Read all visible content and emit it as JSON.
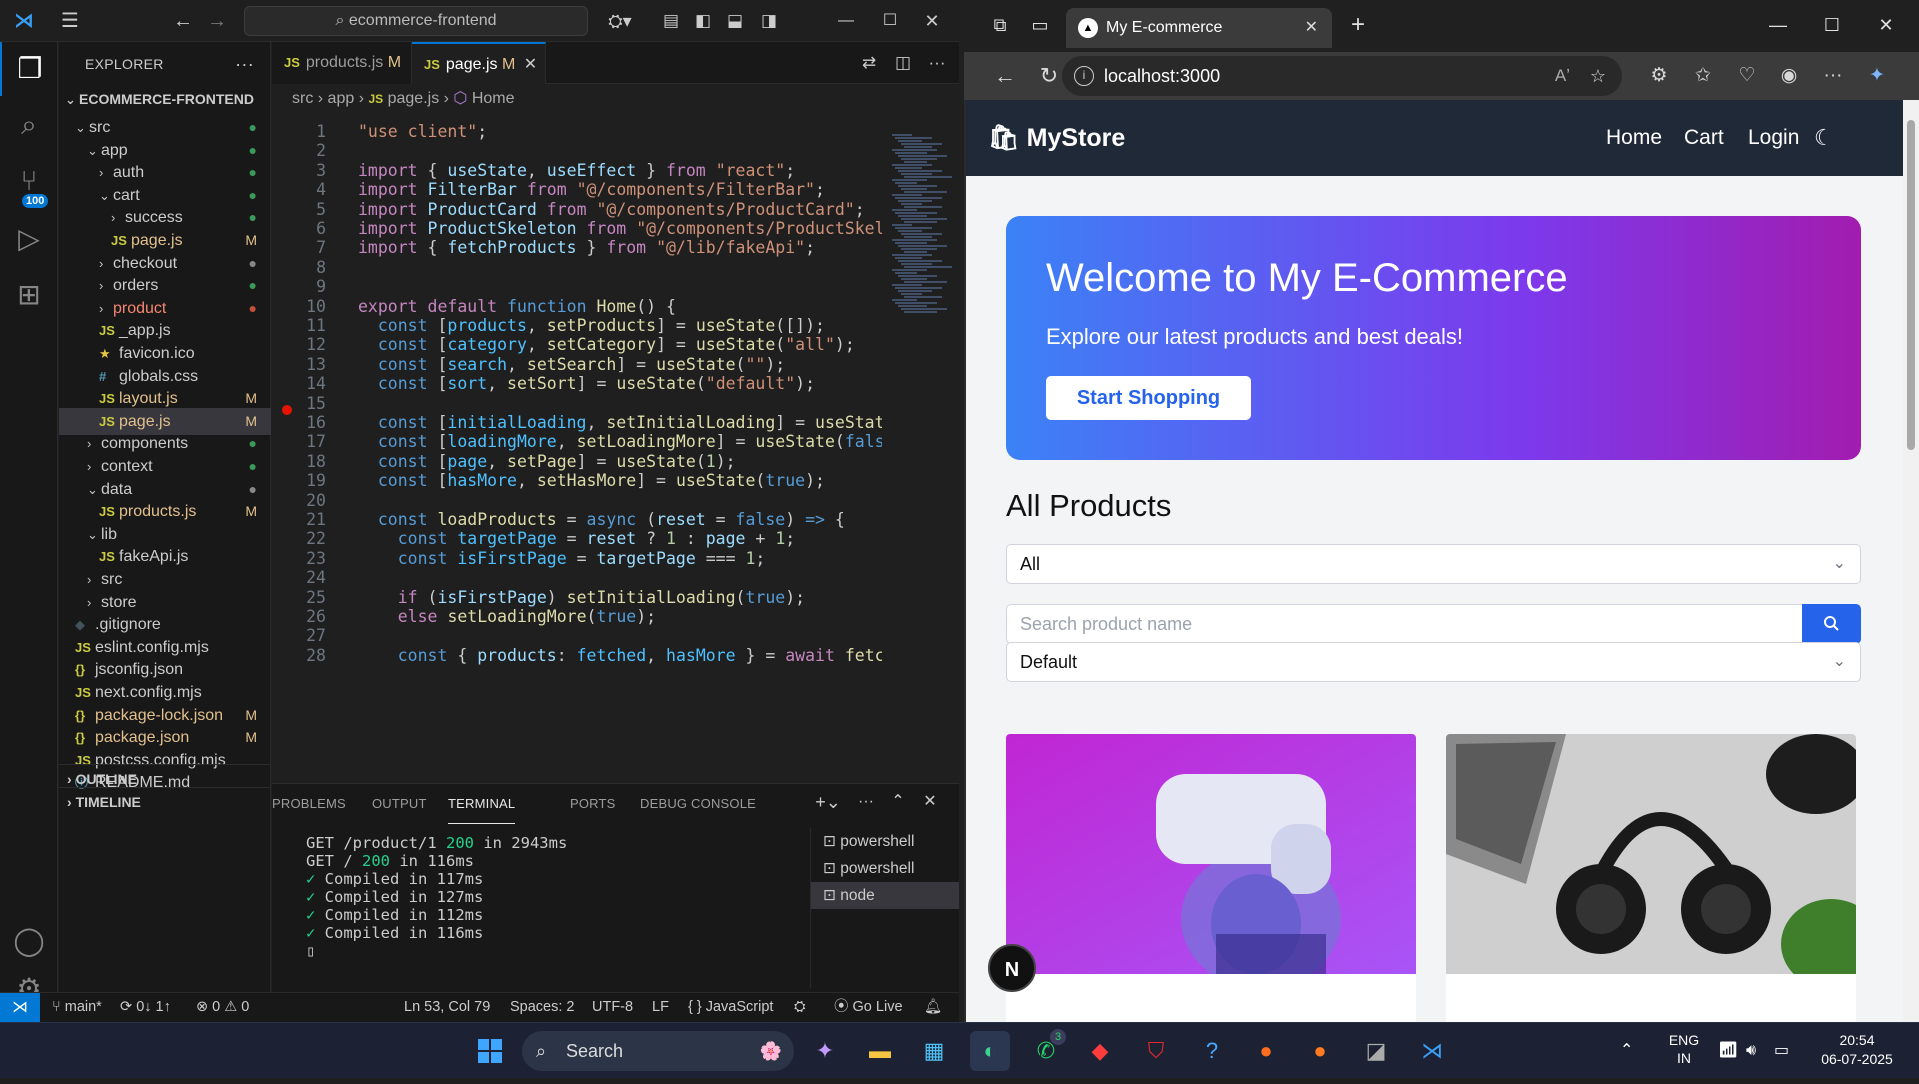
{
  "vscode": {
    "command_center": "ecommerce-frontend",
    "explorer_title": "EXPLORER",
    "root_folder": "ECOMMERCE-FRONTEND",
    "tree": [
      {
        "label": "src",
        "type": "folder-open",
        "indent": 1,
        "deco": "dot-g"
      },
      {
        "label": "app",
        "type": "folder-open",
        "indent": 2,
        "deco": "dot-g"
      },
      {
        "label": "auth",
        "type": "folder",
        "indent": 3,
        "deco": "dot-g"
      },
      {
        "label": "cart",
        "type": "folder-open",
        "indent": 3,
        "deco": "dot-g"
      },
      {
        "label": "success",
        "type": "folder",
        "indent": 4,
        "deco": "dot-g"
      },
      {
        "label": "page.js",
        "type": "js",
        "indent": 4,
        "deco": "M"
      },
      {
        "label": "checkout",
        "type": "folder",
        "indent": 3,
        "deco": "dot"
      },
      {
        "label": "orders",
        "type": "folder",
        "indent": 3,
        "deco": "dot-g"
      },
      {
        "label": "product",
        "type": "folder",
        "indent": 3,
        "deco": "dot-r"
      },
      {
        "label": "_app.js",
        "type": "js",
        "indent": 3,
        "deco": ""
      },
      {
        "label": "favicon.ico",
        "type": "star",
        "indent": 3,
        "deco": ""
      },
      {
        "label": "globals.css",
        "type": "css",
        "indent": 3,
        "deco": ""
      },
      {
        "label": "layout.js",
        "type": "js",
        "indent": 3,
        "deco": "M"
      },
      {
        "label": "page.js",
        "type": "js",
        "indent": 3,
        "deco": "M",
        "selected": true
      },
      {
        "label": "components",
        "type": "folder",
        "indent": 2,
        "deco": "dot-g"
      },
      {
        "label": "context",
        "type": "folder",
        "indent": 2,
        "deco": "dot-g"
      },
      {
        "label": "data",
        "type": "folder-open",
        "indent": 2,
        "deco": "dot"
      },
      {
        "label": "products.js",
        "type": "js",
        "indent": 3,
        "deco": "M"
      },
      {
        "label": "lib",
        "type": "folder-open",
        "indent": 2,
        "deco": ""
      },
      {
        "label": "fakeApi.js",
        "type": "js",
        "indent": 3,
        "deco": ""
      },
      {
        "label": "src",
        "type": "folder",
        "indent": 2,
        "deco": ""
      },
      {
        "label": "store",
        "type": "folder",
        "indent": 2,
        "deco": ""
      },
      {
        "label": ".gitignore",
        "type": "git",
        "indent": 1,
        "deco": ""
      },
      {
        "label": "eslint.config.mjs",
        "type": "js",
        "indent": 1,
        "deco": ""
      },
      {
        "label": "jsconfig.json",
        "type": "json",
        "indent": 1,
        "deco": ""
      },
      {
        "label": "next.config.mjs",
        "type": "js",
        "indent": 1,
        "deco": ""
      },
      {
        "label": "package-lock.json",
        "type": "json",
        "indent": 1,
        "deco": "M"
      },
      {
        "label": "package.json",
        "type": "json",
        "indent": 1,
        "deco": "M"
      },
      {
        "label": "postcss.config.mjs",
        "type": "js",
        "indent": 1,
        "deco": ""
      },
      {
        "label": "README.md",
        "type": "md",
        "indent": 1,
        "deco": ""
      }
    ],
    "outline": "OUTLINE",
    "timeline": "TIMELINE",
    "tabs": [
      {
        "label": "products.js",
        "mod": "M"
      },
      {
        "label": "page.js",
        "mod": "M"
      }
    ],
    "breadcrumb": [
      "src",
      "app",
      "page.js",
      "Home"
    ],
    "code": [
      {
        "n": "1",
        "html": "<span class='str'>\"use client\"</span>;"
      },
      {
        "n": "2",
        "html": ""
      },
      {
        "n": "3",
        "html": "<span class='kw'>import</span> { <span class='var'>useState</span>, <span class='var'>useEffect</span> } <span class='kw'>from</span> <span class='str'>\"react\"</span>;"
      },
      {
        "n": "4",
        "html": "<span class='kw'>import</span> <span class='var'>FilterBar</span> <span class='kw'>from</span> <span class='str'>\"@/components/FilterBar\"</span>;"
      },
      {
        "n": "5",
        "html": "<span class='kw'>import</span> <span class='var'>ProductCard</span> <span class='kw'>from</span> <span class='str'>\"@/components/ProductCard\"</span>;"
      },
      {
        "n": "6",
        "html": "<span class='kw'>import</span> <span class='var'>ProductSkeleton</span> <span class='kw'>from</span> <span class='str'>\"@/components/ProductSkeleto</span>"
      },
      {
        "n": "7",
        "html": "<span class='kw'>import</span> { <span class='var'>fetchProducts</span> } <span class='kw'>from</span> <span class='str'>\"@/lib/fakeApi\"</span>;"
      },
      {
        "n": "8",
        "html": ""
      },
      {
        "n": "9",
        "html": ""
      },
      {
        "n": "10",
        "html": "<span class='kw'>export</span> <span class='kw'>default</span> <span class='kw2'>function</span> <span class='fn'>Home</span>() {"
      },
      {
        "n": "11",
        "html": "  <span class='kw2'>const</span> [<span class='ty'>products</span>, <span class='fn'>setProducts</span>] = <span class='fn'>useState</span>([]);"
      },
      {
        "n": "12",
        "html": "  <span class='kw2'>const</span> [<span class='ty'>category</span>, <span class='fn'>setCategory</span>] = <span class='fn'>useState</span>(<span class='str'>\"all\"</span>);"
      },
      {
        "n": "13",
        "html": "  <span class='kw2'>const</span> [<span class='ty'>search</span>, <span class='fn'>setSearch</span>] = <span class='fn'>useState</span>(<span class='str'>\"\"</span>);"
      },
      {
        "n": "14",
        "html": "  <span class='kw2'>const</span> [<span class='ty'>sort</span>, <span class='fn'>setSort</span>] = <span class='fn'>useState</span>(<span class='str'>\"default\"</span>);"
      },
      {
        "n": "15",
        "html": ""
      },
      {
        "n": "16",
        "html": "  <span class='kw2'>const</span> [<span class='ty'>initialLoading</span>, <span class='fn'>setInitialLoading</span>] = <span class='fn'>useState</span>"
      },
      {
        "n": "17",
        "html": "  <span class='kw2'>const</span> [<span class='ty'>loadingMore</span>, <span class='fn'>setLoadingMore</span>] = <span class='fn'>useState</span>(<span class='kw2'>false</span>"
      },
      {
        "n": "18",
        "html": "  <span class='kw2'>const</span> [<span class='ty'>page</span>, <span class='fn'>setPage</span>] = <span class='fn'>useState</span>(<span class='num'>1</span>);"
      },
      {
        "n": "19",
        "html": "  <span class='kw2'>const</span> [<span class='ty'>hasMore</span>, <span class='fn'>setHasMore</span>] = <span class='fn'>useState</span>(<span class='kw2'>true</span>);"
      },
      {
        "n": "20",
        "html": ""
      },
      {
        "n": "21",
        "html": "  <span class='kw2'>const</span> <span class='fn'>loadProducts</span> = <span class='kw2'>async</span> (<span class='var'>reset</span> = <span class='kw2'>false</span>) <span class='kw2'>=&gt;</span> {"
      },
      {
        "n": "22",
        "html": "    <span class='kw2'>const</span> <span class='ty'>targetPage</span> = <span class='var'>reset</span> ? <span class='num'>1</span> : <span class='var'>page</span> + <span class='num'>1</span>;"
      },
      {
        "n": "23",
        "html": "    <span class='kw2'>const</span> <span class='ty'>isFirstPage</span> = <span class='var'>targetPage</span> === <span class='num'>1</span>;"
      },
      {
        "n": "24",
        "html": ""
      },
      {
        "n": "25",
        "html": "    <span class='kw'>if</span> (<span class='var'>isFirstPage</span>) <span class='fn'>setInitialLoading</span>(<span class='kw2'>true</span>);"
      },
      {
        "n": "26",
        "html": "    <span class='kw'>else</span> <span class='fn'>setLoadingMore</span>(<span class='kw2'>true</span>);"
      },
      {
        "n": "27",
        "html": ""
      },
      {
        "n": "28",
        "html": "    <span class='kw2'>const</span> { <span class='var'>products</span>: <span class='ty'>fetched</span>, <span class='ty'>hasMore</span> } = <span class='kw'>await</span> <span class='fn'>fetch</span>"
      }
    ],
    "panel_tabs": [
      "PROBLEMS",
      "OUTPUT",
      "TERMINAL",
      "PORTS",
      "DEBUG CONSOLE"
    ],
    "terminal": [
      {
        "t": "GET /product/1 ",
        "g": "200",
        "r": " in 2943ms"
      },
      {
        "t": "GET / ",
        "g": "200",
        "r": " in 116ms"
      },
      {
        "tick": "✓",
        "t": " Compiled in 117ms"
      },
      {
        "tick": "✓",
        "t": " Compiled in 127ms"
      },
      {
        "tick": "✓",
        "t": " Compiled in 112ms"
      },
      {
        "tick": "✓",
        "t": " Compiled in 116ms"
      }
    ],
    "terminals": [
      "powershell",
      "powershell",
      "node"
    ],
    "status": {
      "branch": "main*",
      "sync": "0↓ 1↑",
      "problems": "⊗ 0 ⚠ 0",
      "position": "Ln 53, Col 79",
      "spaces": "Spaces: 2",
      "encoding": "UTF-8",
      "eol": "LF",
      "language": "{ } JavaScript",
      "golive": "Go Live"
    },
    "activity_badge": "100"
  },
  "browser": {
    "tab_title": "My E-commerce",
    "url": "localhost:3000",
    "store": {
      "logo": "🛍 MyStore",
      "nav": [
        "Home",
        "Cart",
        "Login"
      ],
      "hero_title": "Welcome to My E-Commerce",
      "hero_sub": "Explore our latest products and best deals!",
      "hero_btn": "Start Shopping",
      "section_title": "All Products",
      "category_value": "All",
      "search_placeholder": "Search product name",
      "sort_value": "Default",
      "next_badge": "N"
    }
  },
  "taskbar": {
    "search": "Search",
    "lang": "ENG",
    "region": "IN",
    "time": "20:54",
    "date": "06-07-2025",
    "whatsapp_badge": "3"
  }
}
